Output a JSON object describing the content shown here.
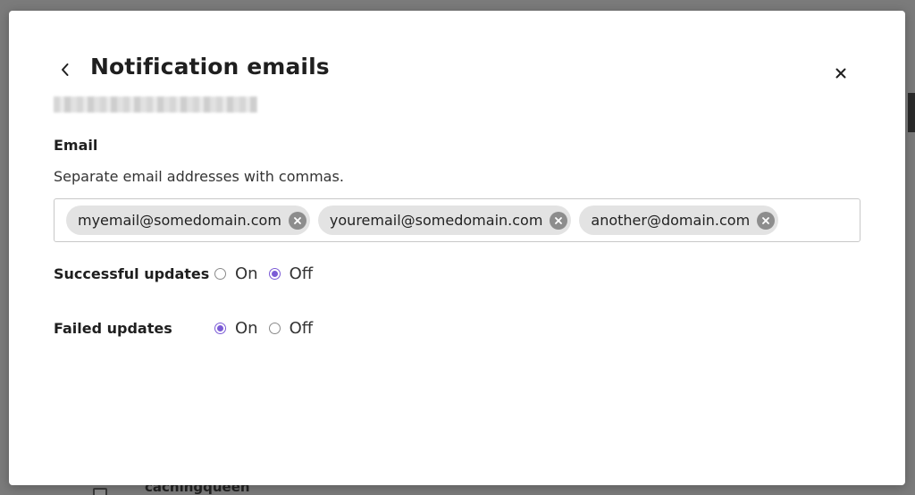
{
  "modal": {
    "title": "Notification emails",
    "back_icon": "chevron-left-icon",
    "close_icon": "close-icon"
  },
  "email": {
    "section_label": "Email",
    "helper_text": "Separate email addresses with commas.",
    "chips": [
      "myemail@somedomain.com",
      "youremail@somedomain.com",
      "another@domain.com"
    ]
  },
  "settings": [
    {
      "label": "Successful updates",
      "options": [
        {
          "label": "On",
          "selected": false
        },
        {
          "label": "Off",
          "selected": true
        }
      ]
    },
    {
      "label": "Failed updates",
      "options": [
        {
          "label": "On",
          "selected": true
        },
        {
          "label": "Off",
          "selected": false
        }
      ]
    }
  ],
  "background": {
    "list_item_text": "cachingqueen"
  },
  "colors": {
    "accent": "#7b5bd6",
    "chip_bg": "#e3e3e3",
    "backdrop": "#7b7b7b"
  }
}
